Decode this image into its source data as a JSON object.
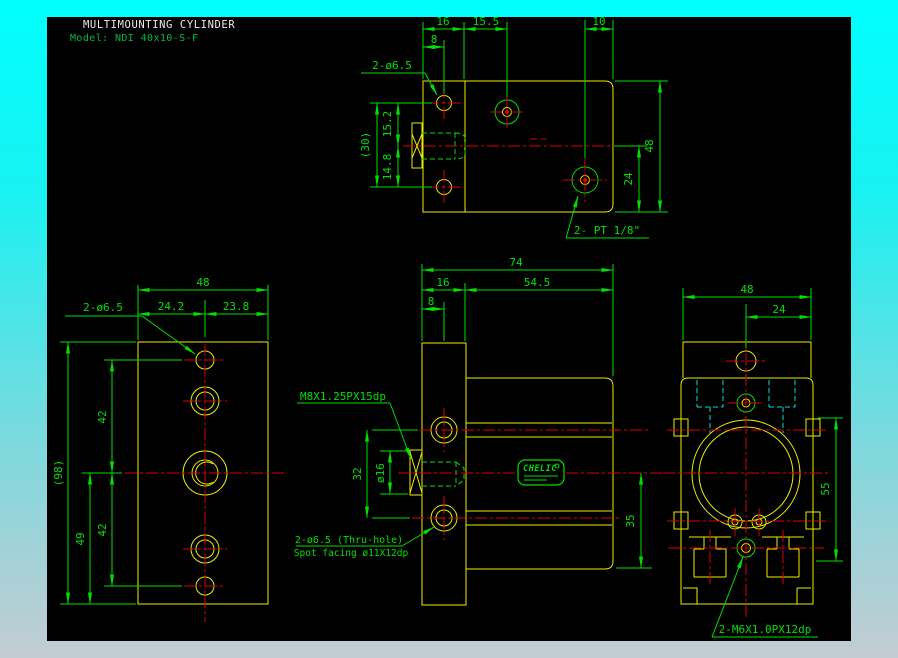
{
  "title": {
    "product": "MULTIMOUNTING CYLINDER",
    "model": "Model: NDI 40x10-S-F"
  },
  "colors": {
    "line_yellow": "#eded00",
    "line_green": "#00e000",
    "centerline_red": "#dd0000",
    "hidden_cyan": "#00dede",
    "title_white": "#ececec",
    "canvas_black": "#000000",
    "background_top": "#00ffff",
    "background_bottom": "#c3ccd2"
  },
  "top_view": {
    "dim_width_flange": "16",
    "dim_width_mid": "15.5",
    "dim_width_port": "10",
    "dim_hole_offset": "8",
    "label_holes": "2-ø6.5",
    "dim_total_height": "(30)",
    "dim_upper": "15.2",
    "dim_lower": "14.8",
    "dim_depth": "48",
    "dim_port_offset": "24",
    "label_port": "2- PT 1/8\""
  },
  "left_view": {
    "dim_width": "48",
    "dim_left": "24.2",
    "dim_right": "23.8",
    "label_holes": "2-ø6.5",
    "dim_total": "(98)",
    "dim_lower": "49",
    "dim_upper_pitch": "42",
    "dim_lower_pitch": "42"
  },
  "front_view": {
    "dim_total_width": "74",
    "dim_flange": "16",
    "dim_body": "54.5",
    "dim_hole": "8",
    "label_rod_thread": "M8X1.25PX15dp",
    "dim_hole_pitch": "32",
    "dim_rod": "ø16",
    "label_thru_hole": "2-ø6.5 (Thru-hole)",
    "label_spot_facing": "Spot facing ø11X12dp",
    "dim_port_offset": "35",
    "logo": "CHELIC"
  },
  "right_view": {
    "dim_width": "48",
    "dim_half": "24",
    "dim_height": "55",
    "label_mount_thread": "2-M6X1.0PX12dp"
  }
}
